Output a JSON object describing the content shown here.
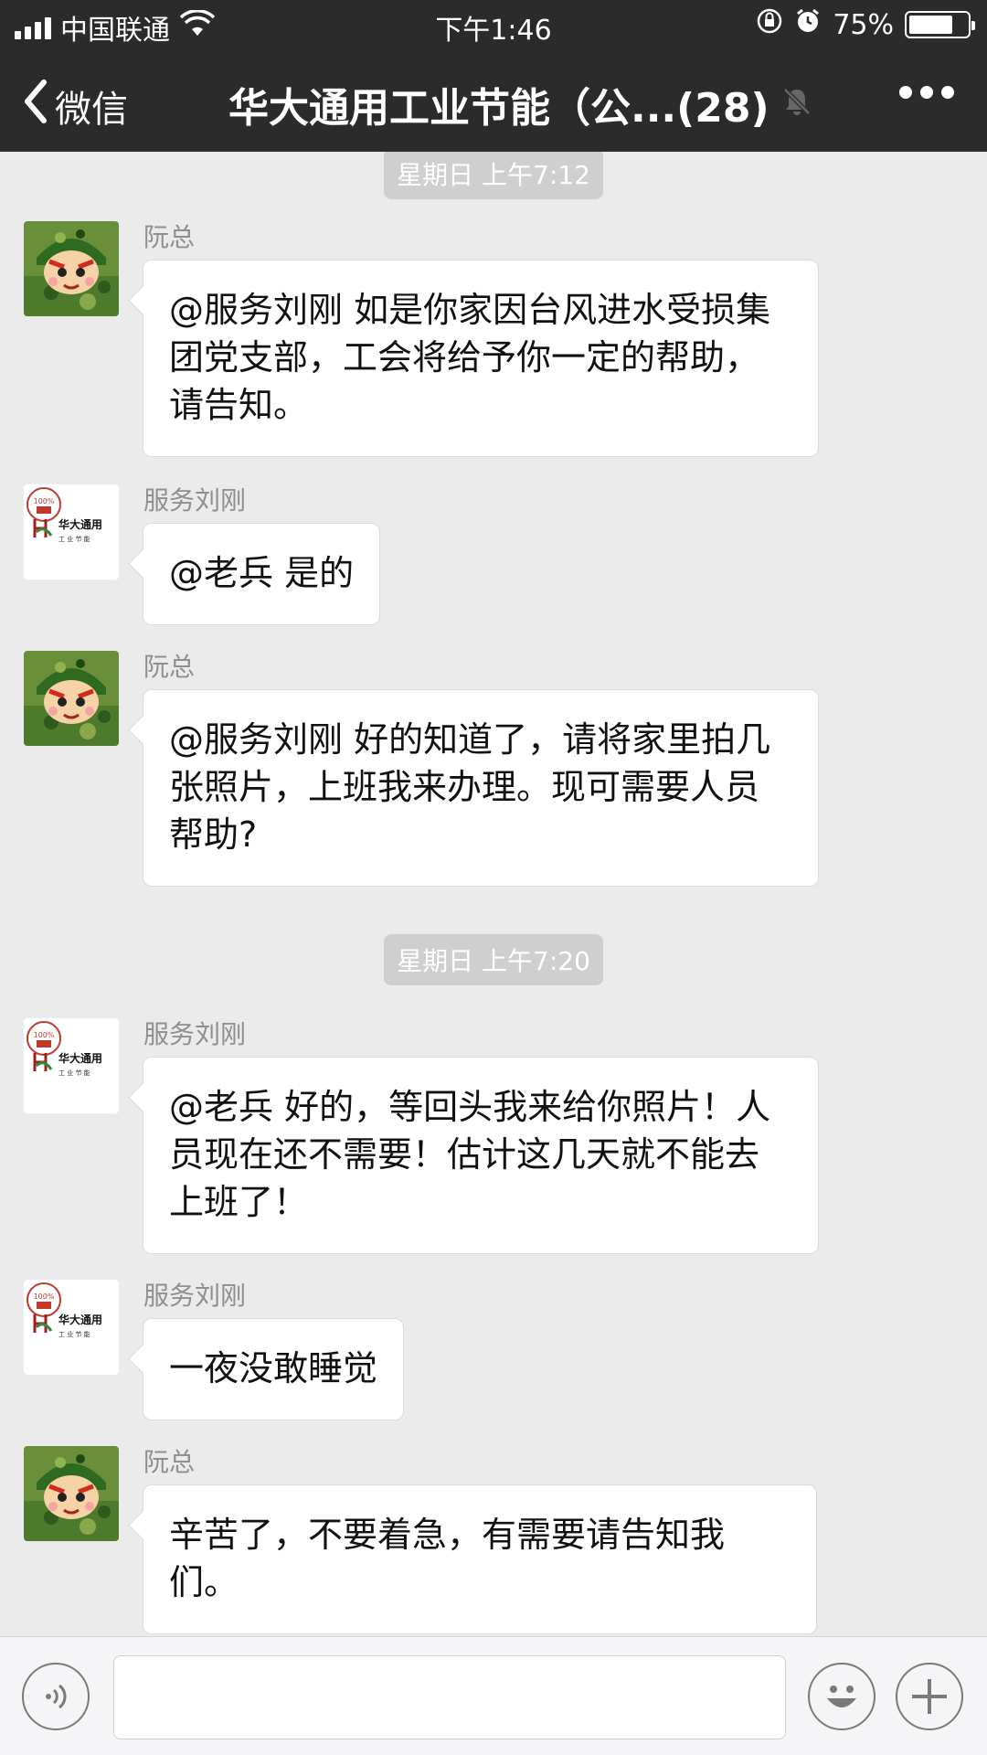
{
  "status_bar": {
    "carrier": "中国联通",
    "time": "下午1:46",
    "battery_text": "75%",
    "battery_level": 0.75
  },
  "nav": {
    "back_label": "微信",
    "title": "华大通用工业节能（公...(28)"
  },
  "timestamps": [
    "星期日 上午7:12",
    "星期日 上午7:20"
  ],
  "messages": [
    {
      "sender": "阮总",
      "text": "@服务刘刚 如是你家因台风进水受损集团党支部，工会将给予你一定的帮助，请告知。"
    },
    {
      "sender": "服务刘刚",
      "text": "@老兵 是的"
    },
    {
      "sender": "阮总",
      "text": "@服务刘刚 好的知道了，请将家里拍几张照片，上班我来办理。现可需要人员帮助?"
    },
    {
      "sender": "服务刘刚",
      "text": "@老兵 好的，等回头我来给你照片！人员现在还不需要！估计这几天就不能去上班了！"
    },
    {
      "sender": "服务刘刚",
      "text": "一夜没敢睡觉"
    },
    {
      "sender": "阮总",
      "text": "辛苦了，不要着急，有需要请告知我们。"
    }
  ],
  "company_logo": {
    "line1": "华大通用",
    "line2": "工 业 节 能",
    "badge": "100%"
  },
  "colors": {
    "topbar": "#2b2b2b",
    "chat_bg": "#ebebeb",
    "bubble": "#ffffff",
    "meta_text": "#8f8f8f"
  },
  "icons": {
    "back": "chevron-left-icon",
    "mute": "bell-off-icon",
    "more": "more-dots-icon",
    "voice": "voice-icon",
    "emoji": "emoji-icon",
    "plus": "plus-icon"
  }
}
